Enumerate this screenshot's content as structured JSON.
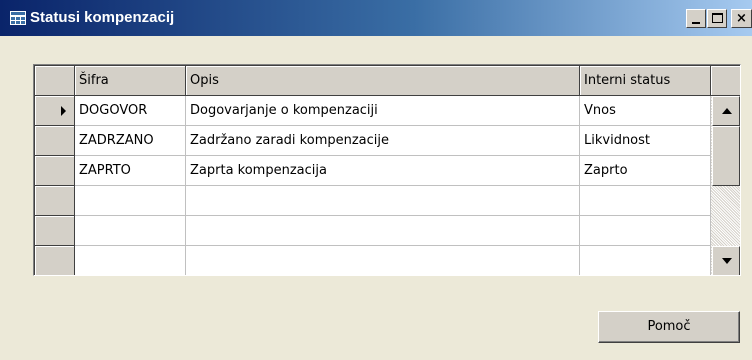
{
  "window": {
    "title": "Statusi kompenzacij",
    "caption_close": "×"
  },
  "grid": {
    "columns": [
      "Šifra",
      "Opis",
      "Interni status"
    ],
    "rows": [
      {
        "code": "DOGOVOR",
        "description": "Dogovarjanje o kompenzaciji",
        "status": "Vnos",
        "current": true
      },
      {
        "code": "ZADRZANO",
        "description": "Zadržano zaradi kompenzacije",
        "status": "Likvidnost",
        "current": false
      },
      {
        "code": "ZAPRTO",
        "description": "Zaprta kompenzacija",
        "status": "Zaprto",
        "current": false
      },
      {
        "code": "",
        "description": "",
        "status": "",
        "current": false
      },
      {
        "code": "",
        "description": "",
        "status": "",
        "current": false
      },
      {
        "code": "",
        "description": "",
        "status": "",
        "current": false
      }
    ]
  },
  "buttons": {
    "help_label": "Pomoč"
  },
  "icons": [
    "table-icon",
    "minimize-icon",
    "maximize-icon",
    "close-icon",
    "row-pointer-icon",
    "scroll-up-icon",
    "scroll-down-icon"
  ]
}
